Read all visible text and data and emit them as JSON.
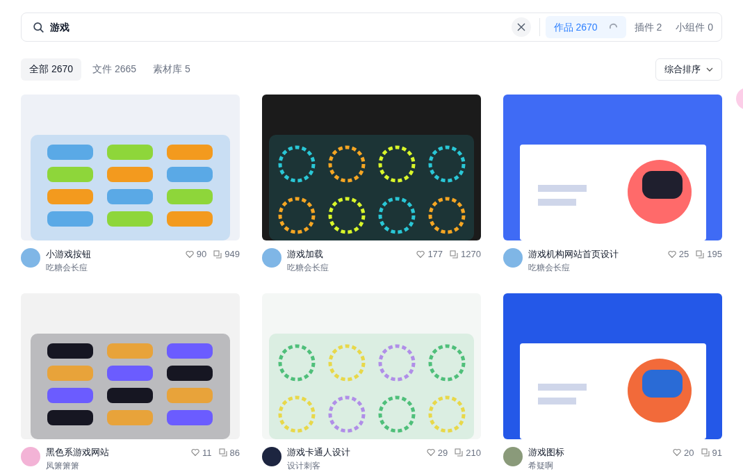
{
  "search": {
    "value": "游戏"
  },
  "scopes": [
    {
      "label": "作品",
      "count": "2670",
      "selected": true,
      "loading": true
    },
    {
      "label": "插件",
      "count": "2",
      "selected": false,
      "loading": false
    },
    {
      "label": "小组件",
      "count": "0",
      "selected": false,
      "loading": false
    }
  ],
  "filters": [
    {
      "label": "全部",
      "count": "2670",
      "selected": true
    },
    {
      "label": "文件",
      "count": "2665",
      "selected": false
    },
    {
      "label": "素材库",
      "count": "5",
      "selected": false
    }
  ],
  "sort": {
    "label": "综合排序"
  },
  "works": [
    {
      "title": "小游戏按钮",
      "likes": "90",
      "copies": "949",
      "author": "吃糖会长痘"
    },
    {
      "title": "游戏加载",
      "likes": "177",
      "copies": "1270",
      "author": "吃糖会长痘"
    },
    {
      "title": "游戏机构网站首页设计",
      "likes": "25",
      "copies": "195",
      "author": "吃糖会长痘"
    },
    {
      "title": "黑色系游戏网站",
      "likes": "11",
      "copies": "86",
      "author": "凤箫箫箫"
    },
    {
      "title": "游戏卡通人设计",
      "likes": "29",
      "copies": "210",
      "author": "设计刺客"
    },
    {
      "title": "游戏图标",
      "likes": "20",
      "copies": "91",
      "author": "希疑啊"
    }
  ]
}
